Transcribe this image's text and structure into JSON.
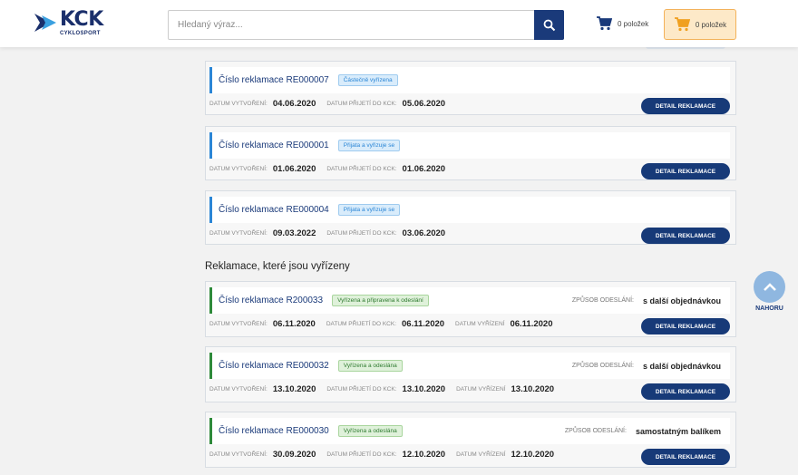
{
  "header": {
    "logo_text": "KCK",
    "logo_sub": "CYKLOSPORT",
    "search_placeholder": "Hledaný výraz...",
    "cart1_label": "0 položek",
    "cart2_label": "0 položek"
  },
  "labels": {
    "created": "DATUM VYTVOŘENÍ:",
    "received": "DATUM PŘIJETÍ DO KCK:",
    "resolved": "DATUM VYŘÍZENÍ",
    "shipping": "ZPŮSOB ODESLÁNÍ:",
    "detail": "DETAIL REKLAMACE"
  },
  "pending": [
    {
      "title": "Číslo reklamace RE000007",
      "status": "Částečně vyřízena",
      "created": "04.06.2020",
      "received": "05.06.2020"
    },
    {
      "title": "Číslo reklamace RE000001",
      "status": "Přijata a vyřizuje se",
      "created": "01.06.2020",
      "received": "01.06.2020"
    },
    {
      "title": "Číslo reklamace RE000004",
      "status": "Přijata a vyřizuje se",
      "created": "09.03.2022",
      "received": "03.06.2020"
    }
  ],
  "resolved_title": "Reklamace, které jsou vyřízeny",
  "resolved": [
    {
      "title": "Číslo reklamace R200033",
      "status": "Vyřízena a připravena k odeslání",
      "shipping": "s další objednávkou",
      "created": "06.11.2020",
      "received": "06.11.2020",
      "resolved": "06.11.2020"
    },
    {
      "title": "Číslo reklamace RE000032",
      "status": "Vyřízena a odeslána",
      "shipping": "s další objednávkou",
      "created": "13.10.2020",
      "received": "13.10.2020",
      "resolved": "13.10.2020"
    },
    {
      "title": "Číslo reklamace RE000030",
      "status": "Vyřízena a odeslána",
      "shipping": "samostatným balíkem",
      "created": "30.09.2020",
      "received": "12.10.2020",
      "resolved": "12.10.2020"
    }
  ],
  "scroll_top_label": "NAHORU",
  "colors": {
    "brand": "#1a3a7a",
    "pending_bar": "#2b86d6",
    "resolved_bar": "#2e8a3a",
    "cart_highlight": "#fde9c8"
  }
}
